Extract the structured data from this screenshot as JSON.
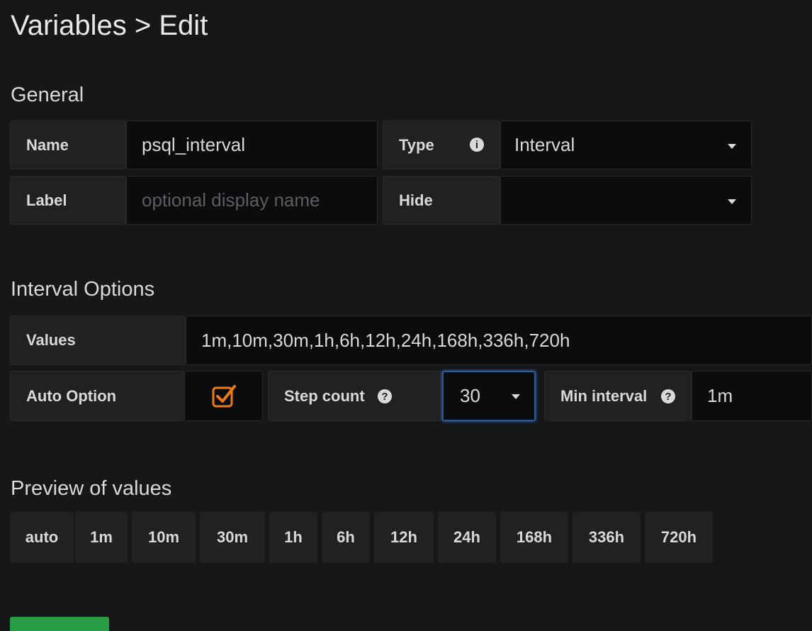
{
  "page": {
    "title": "Variables > Edit"
  },
  "general": {
    "heading": "General",
    "name_label": "Name",
    "name_value": "psql_interval",
    "type_label": "Type",
    "type_value": "Interval",
    "label_label": "Label",
    "label_placeholder": "optional display name",
    "hide_label": "Hide",
    "hide_value": ""
  },
  "interval": {
    "heading": "Interval Options",
    "values_label": "Values",
    "values_value": "1m,10m,30m,1h,6h,12h,24h,168h,336h,720h",
    "auto_label": "Auto Option",
    "auto_checked": true,
    "step_label": "Step count",
    "step_value": "30",
    "min_label": "Min interval",
    "min_value": "1m"
  },
  "preview": {
    "heading": "Preview of values",
    "values": [
      "auto",
      "1m",
      "10m",
      "30m",
      "1h",
      "6h",
      "12h",
      "24h",
      "168h",
      "336h",
      "720h"
    ]
  },
  "icons": {
    "info": "info-icon",
    "help": "question-circle-icon",
    "caret": "caret-down-icon",
    "checkbox": "checkbox-checked-icon"
  },
  "colors": {
    "background": "#161719",
    "accent_orange": "#eb7b18",
    "focus_blue": "#3274d9",
    "primary_green": "#299c46"
  }
}
